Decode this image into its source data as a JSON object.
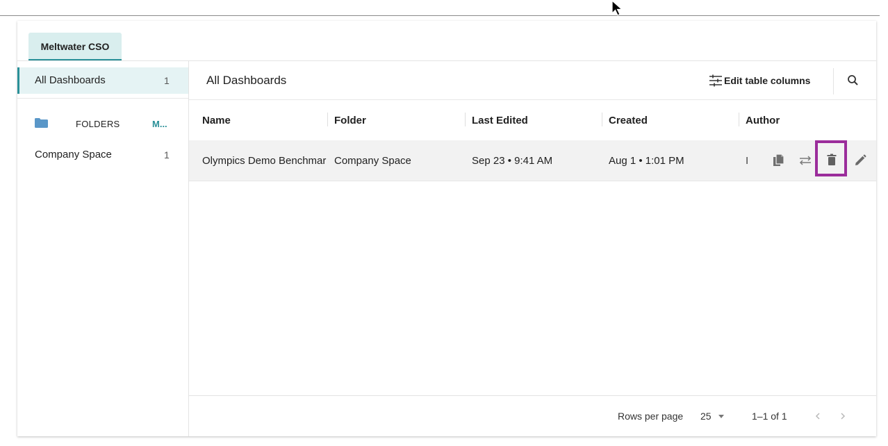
{
  "tabs": [
    {
      "label": "Meltwater CSO"
    }
  ],
  "sidebar": {
    "all": {
      "label": "All Dashboards",
      "count": "1"
    },
    "folders_header": {
      "label": "FOLDERS",
      "more": "M..."
    },
    "folders": [
      {
        "label": "Company Space",
        "count": "1"
      }
    ]
  },
  "main": {
    "title": "All Dashboards",
    "edit_columns_label": "Edit table columns",
    "columns": [
      "Name",
      "Folder",
      "Last Edited",
      "Created",
      "Author"
    ],
    "rows": [
      {
        "name": "Olympics Demo Benchmar",
        "folder": "Company Space",
        "last_edited": "Sep 23 • 9:41 AM",
        "created": "Aug 1 • 1:01 PM",
        "author": "I"
      }
    ],
    "footer": {
      "rows_per_page_label": "Rows per page",
      "rows_per_page_value": "25",
      "range": "1–1 of 1"
    }
  },
  "colors": {
    "accent": "#2a9098",
    "tab_bg": "#d9eeee",
    "highlight": "#9b2d9b",
    "row_bg": "#f2f2f2"
  },
  "icons": [
    "folder-icon",
    "tune-icon",
    "search-icon",
    "copy-icon",
    "swap-icon",
    "delete-icon",
    "edit-icon",
    "chevron-left-icon",
    "chevron-right-icon",
    "cursor-icon"
  ]
}
